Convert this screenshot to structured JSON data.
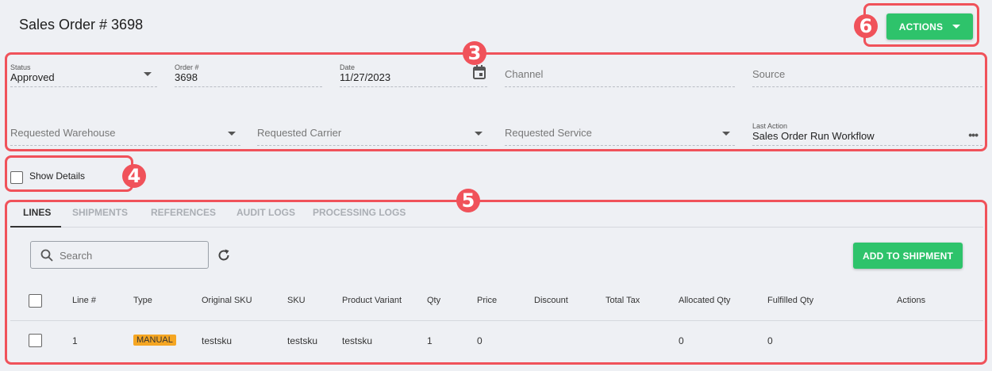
{
  "header": {
    "title": "Sales Order # 3698",
    "actions_label": "ACTIONS"
  },
  "callouts": {
    "three": "3",
    "four": "4",
    "five": "5",
    "six": "6"
  },
  "form": {
    "status": {
      "label": "Status",
      "value": "Approved"
    },
    "order": {
      "label": "Order #",
      "value": "3698"
    },
    "date": {
      "label": "Date",
      "value": "11/27/2023"
    },
    "channel": {
      "placeholder": "Channel"
    },
    "source": {
      "placeholder": "Source"
    },
    "requested_warehouse": {
      "placeholder": "Requested Warehouse"
    },
    "requested_carrier": {
      "placeholder": "Requested Carrier"
    },
    "requested_service": {
      "placeholder": "Requested Service"
    },
    "last_action": {
      "label": "Last Action",
      "value": "Sales Order Run Workflow"
    }
  },
  "show_details": {
    "label": "Show Details",
    "checked": false
  },
  "tabs": [
    {
      "label": "LINES",
      "active": true
    },
    {
      "label": "SHIPMENTS",
      "active": false
    },
    {
      "label": "REFERENCES",
      "active": false
    },
    {
      "label": "AUDIT LOGS",
      "active": false
    },
    {
      "label": "PROCESSING LOGS",
      "active": false
    }
  ],
  "search": {
    "placeholder": "Search"
  },
  "add_to_shipment_label": "ADD TO SHIPMENT",
  "table": {
    "columns": [
      "Line #",
      "Type",
      "Original SKU",
      "SKU",
      "Product Variant",
      "Qty",
      "Price",
      "Discount",
      "Total Tax",
      "Allocated Qty",
      "Fulfilled Qty",
      "Actions"
    ],
    "rows": [
      {
        "line": "1",
        "type": "MANUAL",
        "original_sku": "testsku",
        "sku": "testsku",
        "product_variant": "testsku",
        "qty": "1",
        "price": "0",
        "discount": "",
        "total_tax": "",
        "allocated_qty": "0",
        "fulfilled_qty": "0"
      }
    ]
  },
  "colors": {
    "callout": "#f0525a",
    "primary_button": "#2ec36b",
    "manual_badge": "#f5a623",
    "background": "#eef0f4"
  },
  "icons": [
    "caret-down-icon",
    "calendar-icon",
    "more-horizontal-icon",
    "search-icon",
    "refresh-icon"
  ]
}
